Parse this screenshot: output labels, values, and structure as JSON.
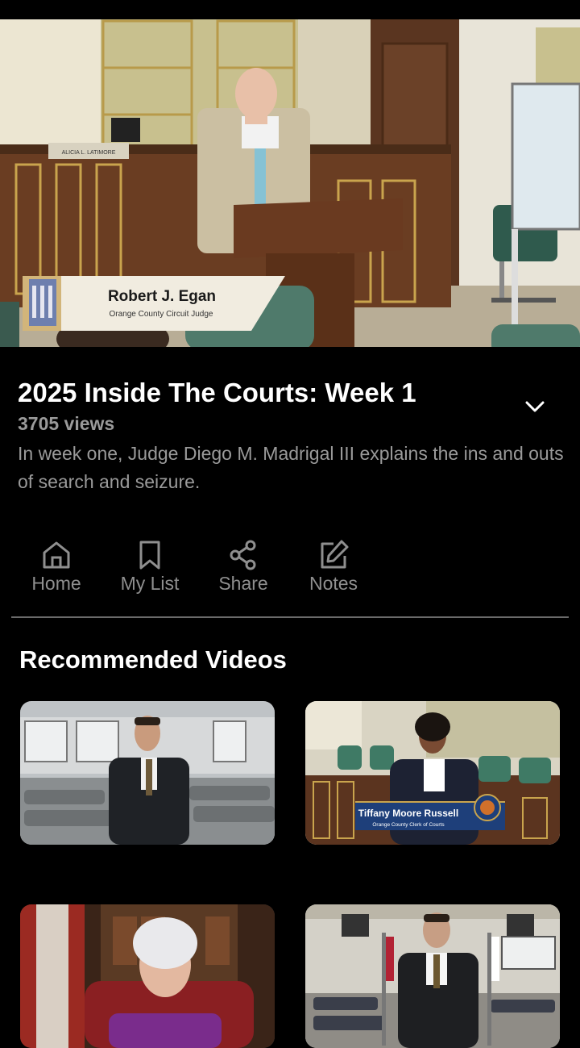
{
  "player": {
    "nameplate_name": "Robert J. Egan",
    "nameplate_title": "Orange County Circuit Judge",
    "desk_sign": "ALICIA L. LATIMORE"
  },
  "video": {
    "title": "2025 Inside The Courts: Week 1",
    "views": "3705 views",
    "description": "In week one, Judge Diego M. Madrigal III explains the ins and outs of search and seizure."
  },
  "actions": [
    {
      "label": "Home",
      "icon": "home-icon"
    },
    {
      "label": "My List",
      "icon": "bookmark-icon"
    },
    {
      "label": "Share",
      "icon": "share-icon"
    },
    {
      "label": "Notes",
      "icon": "notes-icon"
    }
  ],
  "recommended": {
    "heading": "Recommended Videos",
    "items": [
      {
        "caption_name": "",
        "caption_title": ""
      },
      {
        "caption_name": "Tiffany Moore Russell",
        "caption_title": "Orange County Clerk of Courts"
      },
      {
        "caption_name": "",
        "caption_title": ""
      },
      {
        "caption_name": "",
        "caption_title": ""
      }
    ]
  },
  "colors": {
    "background": "#000000",
    "muted_text": "#9a9a9a",
    "divider": "#6a6a6a"
  }
}
